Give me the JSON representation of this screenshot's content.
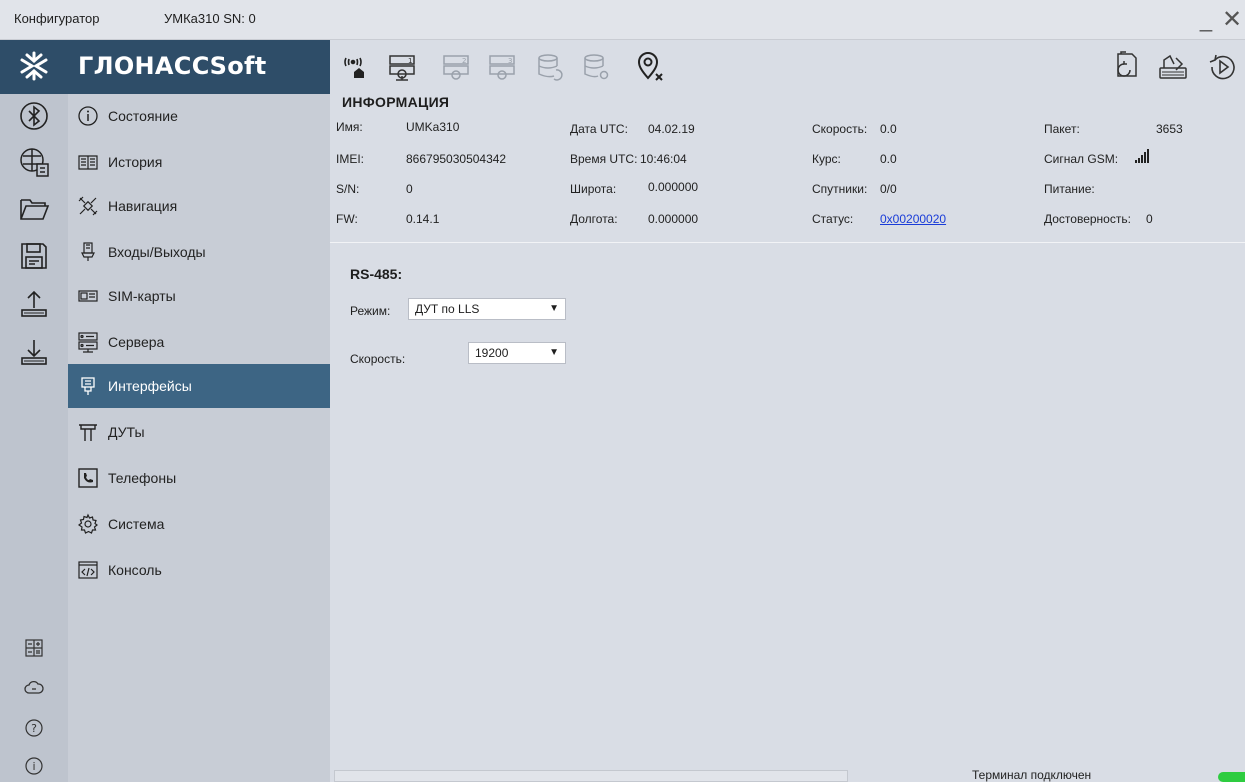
{
  "titlebar": {
    "app_name": "Конфигуратор",
    "device": "УМКа310 SN: 0",
    "minimize": "—",
    "close": "✕"
  },
  "logo": {
    "text": "ГЛОНАССSoft"
  },
  "toolbar": {
    "left_icons": [
      "antenna-home-icon",
      "server-location-1-icon",
      "server-location-2-icon",
      "server-location-3-icon",
      "database-refresh-icon",
      "database-settings-icon",
      "location-off-icon"
    ],
    "right_icons": [
      "file-refresh-icon",
      "device-write-icon",
      "play-history-icon"
    ]
  },
  "rail": {
    "icons": [
      "bluetooth-icon",
      "usb-modem-icon",
      "folder-open-icon",
      "save-icon",
      "upload-icon",
      "download-icon"
    ],
    "bottom_icons": [
      "calculator-icon",
      "cloud-link-icon",
      "help-icon",
      "info-icon"
    ]
  },
  "nav": {
    "items": [
      {
        "label": "Состояние",
        "icon": "info-circle-icon"
      },
      {
        "label": "История",
        "icon": "book-icon"
      },
      {
        "label": "Навигация",
        "icon": "satellite-icon"
      },
      {
        "label": "Входы/Выходы",
        "icon": "connector-icon"
      },
      {
        "label": "SIM-карты",
        "icon": "sim-card-icon"
      },
      {
        "label": "Сервера",
        "icon": "server-icon"
      },
      {
        "label": "Интерфейсы",
        "icon": "interface-plug-icon"
      },
      {
        "label": "ДУТы",
        "icon": "fuel-sensor-icon"
      },
      {
        "label": "Телефоны",
        "icon": "phone-icon"
      },
      {
        "label": "Система",
        "icon": "gear-icon"
      },
      {
        "label": "Консоль",
        "icon": "console-icon"
      }
    ],
    "active_index": 6
  },
  "info": {
    "title": "ИНФОРМАЦИЯ",
    "rows": [
      {
        "label": "Имя:",
        "value": "UMKa310"
      },
      {
        "label": "IMEI:",
        "value": "866795030504342"
      },
      {
        "label": "S/N:",
        "value": "0"
      },
      {
        "label": "FW:",
        "value": "0.14.1"
      },
      {
        "label": "Дата UTC:",
        "value": "04.02.19"
      },
      {
        "label": "Время UTC:",
        "value": "10:46:04"
      },
      {
        "label": "Широта:",
        "value": "0.000000"
      },
      {
        "label": "Долгота:",
        "value": "0.000000"
      },
      {
        "label": "Скорость:",
        "value": "0.0"
      },
      {
        "label": "Курс:",
        "value": "0.0"
      },
      {
        "label": "Спутники:",
        "value": "0/0"
      },
      {
        "label": "Статус:",
        "value": "0x00200020"
      },
      {
        "label": "Пакет:",
        "value": "3653"
      },
      {
        "label": "Сигнал GSM:",
        "value": ""
      },
      {
        "label": "Питание:",
        "value": ""
      },
      {
        "label": "Достоверность:",
        "value": "0"
      }
    ]
  },
  "rs485": {
    "title": "RS-485:",
    "mode_label": "Режим:",
    "mode_value": "ДУТ по LLS",
    "speed_label": "Скорость:",
    "speed_value": "19200"
  },
  "status": {
    "text": "Терминал подключен",
    "led_color": "#2ecc40"
  }
}
